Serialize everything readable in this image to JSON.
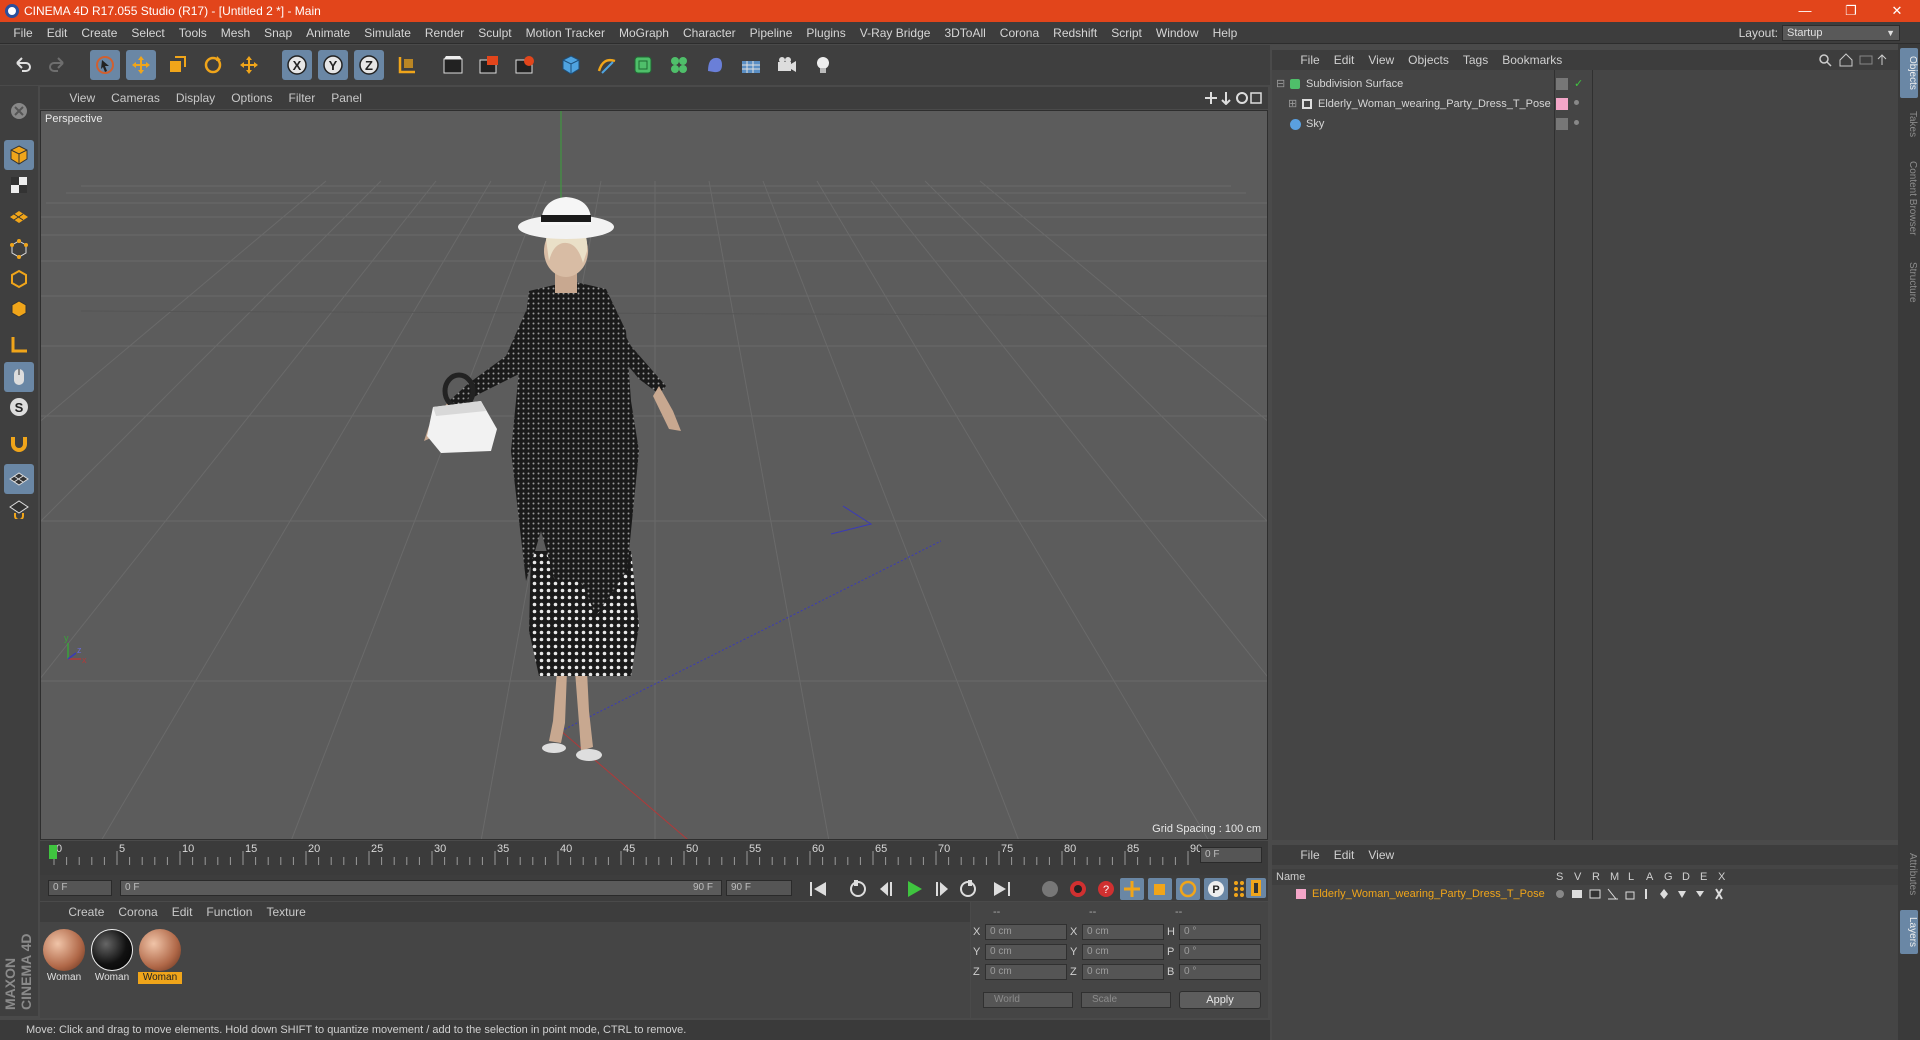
{
  "window": {
    "title": "CINEMA 4D R17.055 Studio (R17) - [Untitled 2 *] - Main",
    "minimize": "—",
    "restore": "❐",
    "close": "✕"
  },
  "menubar": {
    "items": [
      "File",
      "Edit",
      "Create",
      "Select",
      "Tools",
      "Mesh",
      "Snap",
      "Animate",
      "Simulate",
      "Render",
      "Sculpt",
      "Motion Tracker",
      "MoGraph",
      "Character",
      "Pipeline",
      "Plugins",
      "V-Ray Bridge",
      "3DToAll",
      "Corona",
      "Redshift",
      "Script",
      "Window",
      "Help"
    ],
    "layout_label": "Layout:",
    "layout_value": "Startup"
  },
  "toolbar": {
    "icons": [
      "undo-icon",
      "redo-icon",
      "live-selection-icon",
      "move-icon",
      "scale-icon",
      "rotate-icon",
      "recent-tool-icon",
      "x-axis-icon",
      "y-axis-icon",
      "z-axis-icon",
      "world-coordinates-icon",
      "render-view-icon",
      "render-picture-viewer-icon",
      "edit-render-settings-icon",
      "cube-primitive-icon",
      "pen-spline-icon",
      "subdivision-icon",
      "cloner-icon",
      "deformer-icon",
      "floor-icon",
      "camera-icon",
      "light-icon"
    ],
    "axis_labels": [
      "X",
      "Y",
      "Z"
    ]
  },
  "left_toolbar": {
    "icons": [
      "make-editable-icon",
      "model-mode-icon",
      "texture-mode-icon",
      "workplane-icon",
      "points-mode-icon",
      "edges-mode-icon",
      "polygons-mode-icon",
      "axis-mode-icon",
      "tweak-mode-icon",
      "solo-icon",
      "magnet-icon",
      "snap-icon",
      "enable-snap-icon"
    ],
    "solo_label": "S"
  },
  "brand": "MAXON CINEMA 4D",
  "viewport": {
    "menu": [
      "View",
      "Cameras",
      "Display",
      "Options",
      "Filter",
      "Panel"
    ],
    "label": "Perspective",
    "grid_spacing": "Grid Spacing : 100 cm"
  },
  "timeline": {
    "ticks": [
      "0",
      "5",
      "10",
      "15",
      "20",
      "25",
      "30",
      "35",
      "40",
      "45",
      "50",
      "55",
      "60",
      "65",
      "70",
      "75",
      "80",
      "85",
      "90"
    ],
    "current_frame": "0 F",
    "start_field": "0 F",
    "range_start": "0 F",
    "range_end": "90 F",
    "end_field": "90 F"
  },
  "material_manager": {
    "menu": [
      "Create",
      "Corona",
      "Edit",
      "Function",
      "Texture"
    ],
    "materials": [
      {
        "name": "Woman",
        "active": false
      },
      {
        "name": "Woman",
        "active": false
      },
      {
        "name": "Woman",
        "active": true
      }
    ]
  },
  "coordinates": {
    "headers": [
      "--",
      "--",
      "--"
    ],
    "pos_labels": [
      "X",
      "Y",
      "Z"
    ],
    "size_labels": [
      "X",
      "Y",
      "Z"
    ],
    "rot_labels": [
      "H",
      "P",
      "B"
    ],
    "pos_values": [
      "0 cm",
      "0 cm",
      "0 cm"
    ],
    "size_values": [
      "0 cm",
      "0 cm",
      "0 cm"
    ],
    "rot_values": [
      "0 °",
      "0 °",
      "0 °"
    ],
    "mode1": "World",
    "mode2": "Scale",
    "apply": "Apply"
  },
  "status": "Move: Click and drag to move elements. Hold down SHIFT to quantize movement / add to the selection in point mode, CTRL to remove.",
  "object_manager": {
    "menu": [
      "File",
      "Edit",
      "View",
      "Objects",
      "Tags",
      "Bookmarks"
    ],
    "objects": [
      {
        "name": "Subdivision Surface",
        "indent": 0,
        "icon": "subdivision-icon"
      },
      {
        "name": "Elderly_Woman_wearing_Party_Dress_T_Pose",
        "indent": 1,
        "icon": "null-object-icon"
      },
      {
        "name": "Sky",
        "indent": 0,
        "icon": "sky-icon"
      }
    ]
  },
  "layer_manager": {
    "menu": [
      "File",
      "Edit",
      "View"
    ],
    "columns": [
      "Name",
      "S",
      "V",
      "R",
      "M",
      "L",
      "A",
      "G",
      "D",
      "E",
      "X"
    ],
    "layer_name": "Elderly_Woman_wearing_Party_Dress_T_Pose",
    "layer_color": "#f4a6c8"
  },
  "side_tabs": [
    "Objects",
    "Takes",
    "Content Browser",
    "Structure",
    "Attributes",
    "Layers"
  ],
  "colors": {
    "titlebar": "#e2451b",
    "accent": "#6a87a5",
    "active_material": "#f0a51a",
    "layer_text": "#f0a51a"
  }
}
